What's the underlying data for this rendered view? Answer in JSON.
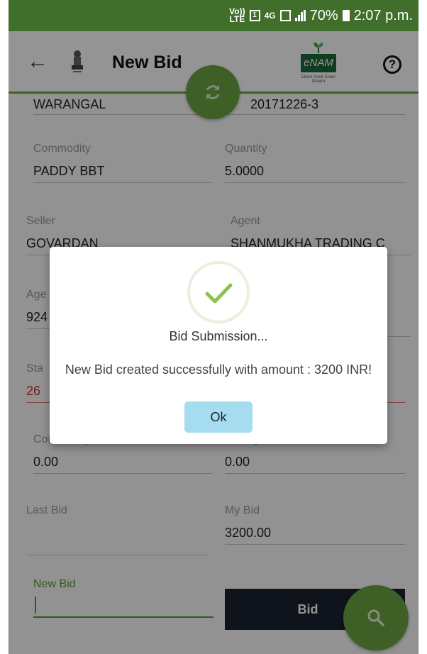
{
  "status_bar": {
    "volte": "Vo)) LTE",
    "sim": "1",
    "network": "4G",
    "battery": "70%",
    "time": "2:07 p.m."
  },
  "app_bar": {
    "title": "New Bid",
    "logo_text": "eNAM",
    "logo_tagline": "Ekam Rastr Ekam Dream",
    "help_label": "?"
  },
  "form": {
    "market": {
      "value": "WARANGAL"
    },
    "lot": {
      "value": "20171226-3"
    },
    "commodity": {
      "label": "Commodity",
      "value": "PADDY BBT"
    },
    "quantity": {
      "label": "Quantity",
      "value": "5.0000"
    },
    "seller": {
      "label": "Seller",
      "value": "GOVARDAN"
    },
    "agent": {
      "label": "Agent",
      "value": "SHANMUKHA TRADING C"
    },
    "agent_phone": {
      "label": "Age",
      "value": "924"
    },
    "status": {
      "label": "Sta",
      "value": "26"
    },
    "commodity_price": {
      "label": "Commodity Price",
      "value": "0.00"
    },
    "selling_price": {
      "label": "Selling Price",
      "value": "0.00"
    },
    "last_bid": {
      "label": "Last Bid",
      "value": ""
    },
    "my_bid": {
      "label": "My Bid",
      "value": "3200.00"
    },
    "new_bid": {
      "label": "New Bid",
      "value": ""
    },
    "bid_button": "Bid"
  },
  "dialog": {
    "title": "Bid Submission...",
    "message": "New Bid created successfully with amount : 3200 INR!",
    "ok_label": "Ok"
  },
  "colors": {
    "accent_green": "#6ba443",
    "status_bar": "#3f6f2a",
    "bid_button": "#1a2230",
    "ok_button": "#a6dcef",
    "error_red": "#d32f2f"
  }
}
